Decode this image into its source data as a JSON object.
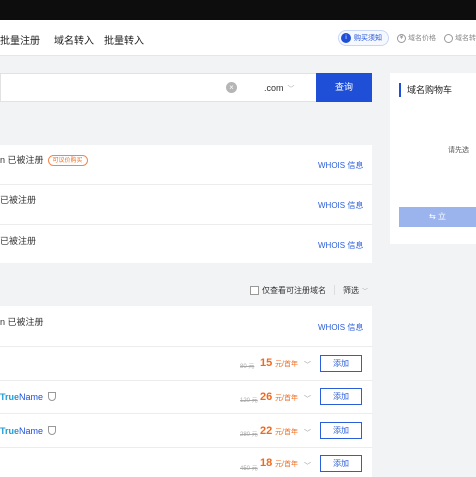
{
  "nav": {
    "tabs": [
      "批量注册",
      "域名转入",
      "批量转入"
    ],
    "notice": "购买须知",
    "notice_icon": "i",
    "price_link": "域名价格",
    "price_icon": "¥",
    "more_link": "域名转"
  },
  "search": {
    "value": "",
    "tld": ".com",
    "button": "查询"
  },
  "results": [
    {
      "text": "n 已被注册",
      "tag": "可议价购买",
      "whois": "WHOIS 信息"
    },
    {
      "text": "已被注册",
      "whois": "WHOIS 信息"
    },
    {
      "text": "已被注册",
      "whois": "WHOIS 信息"
    }
  ],
  "filter": {
    "checkbox_label": "仅查看可注册域名",
    "sort_label": "筛选"
  },
  "list": {
    "registered": {
      "text": "n 已被注册",
      "whois": "WHOIS 信息"
    },
    "items": [
      {
        "brand_t": "",
        "brand_n": "",
        "old": "80 元",
        "price": "15",
        "unit": "元/首年",
        "action": "添加"
      },
      {
        "brand_t": "True",
        "brand_n": "Name",
        "old": "120 元",
        "price": "26",
        "unit": "元/首年",
        "action": "添加"
      },
      {
        "brand_t": "True",
        "brand_n": "Name",
        "old": "280 元",
        "price": "22",
        "unit": "元/首年",
        "action": "添加"
      },
      {
        "brand_t": "",
        "brand_n": "",
        "old": "450 元",
        "price": "18",
        "unit": "元/首年",
        "action": "添加"
      }
    ]
  },
  "cart": {
    "title": "域名购物车",
    "hint": "请先选",
    "button": "立",
    "button_icon": "⇆"
  },
  "colors": {
    "primary": "#1f4fd6",
    "price": "#f06a1d",
    "cart_button": "#9bb4ee"
  }
}
